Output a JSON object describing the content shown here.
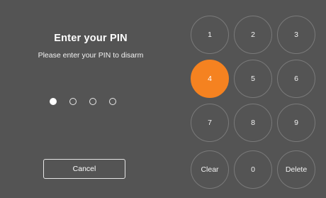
{
  "pin_prompt": {
    "title": "Enter your PIN",
    "subtitle": "Please enter your PIN to disarm",
    "entered_digits": 1,
    "pin_length": 4,
    "cancel_label": "Cancel"
  },
  "keypad": {
    "keys": [
      "1",
      "2",
      "3",
      "4",
      "5",
      "6",
      "7",
      "8",
      "9",
      "Clear",
      "0",
      "Delete"
    ],
    "active_key": "4"
  },
  "colors": {
    "background": "#545454",
    "accent": "#f58220",
    "key_border": "#7a7a7a",
    "text": "#ffffff"
  }
}
